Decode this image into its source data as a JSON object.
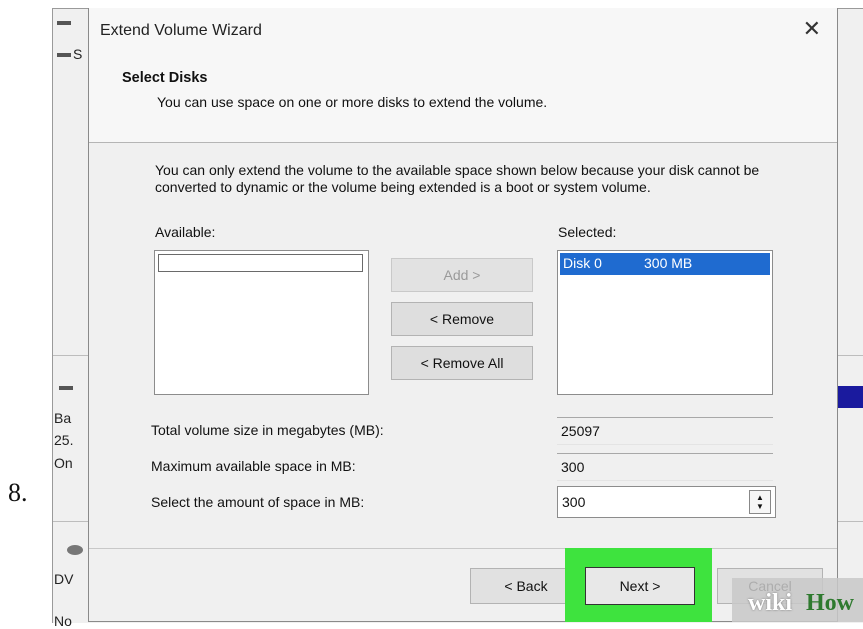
{
  "step_number": "8.",
  "background_window": {
    "left_text": [
      "S",
      "Ba",
      "25.",
      "On",
      "DV",
      "No"
    ]
  },
  "dialog": {
    "title": "Extend Volume Wizard",
    "close_glyph": "✕",
    "section_title": "Select Disks",
    "section_description": "You can use space on one or more disks to extend the volume.",
    "notice": "You can only extend the volume to the available space shown below because your disk cannot be converted to dynamic or the volume being extended is a boot or system volume.",
    "available_label": "Available:",
    "selected_label": "Selected:",
    "selected_items": [
      {
        "disk": "Disk 0",
        "size": "300 MB"
      }
    ],
    "buttons": {
      "add": "Add >",
      "remove": "< Remove",
      "remove_all": "< Remove All"
    },
    "fields": {
      "total_label": "Total volume size in megabytes (MB):",
      "total_value": "25097",
      "max_label": "Maximum available space in MB:",
      "max_value": "300",
      "amount_label": "Select the amount of space in MB:",
      "amount_value": "300"
    },
    "footer": {
      "back": "< Back",
      "next": "Next >",
      "cancel": "Cancel"
    }
  },
  "watermark": {
    "wiki": "wiki",
    "how": "How"
  },
  "colors": {
    "selection": "#1f6bd0",
    "highlight": "#3ee33e",
    "dialog_bg": "#f0f0f0"
  }
}
